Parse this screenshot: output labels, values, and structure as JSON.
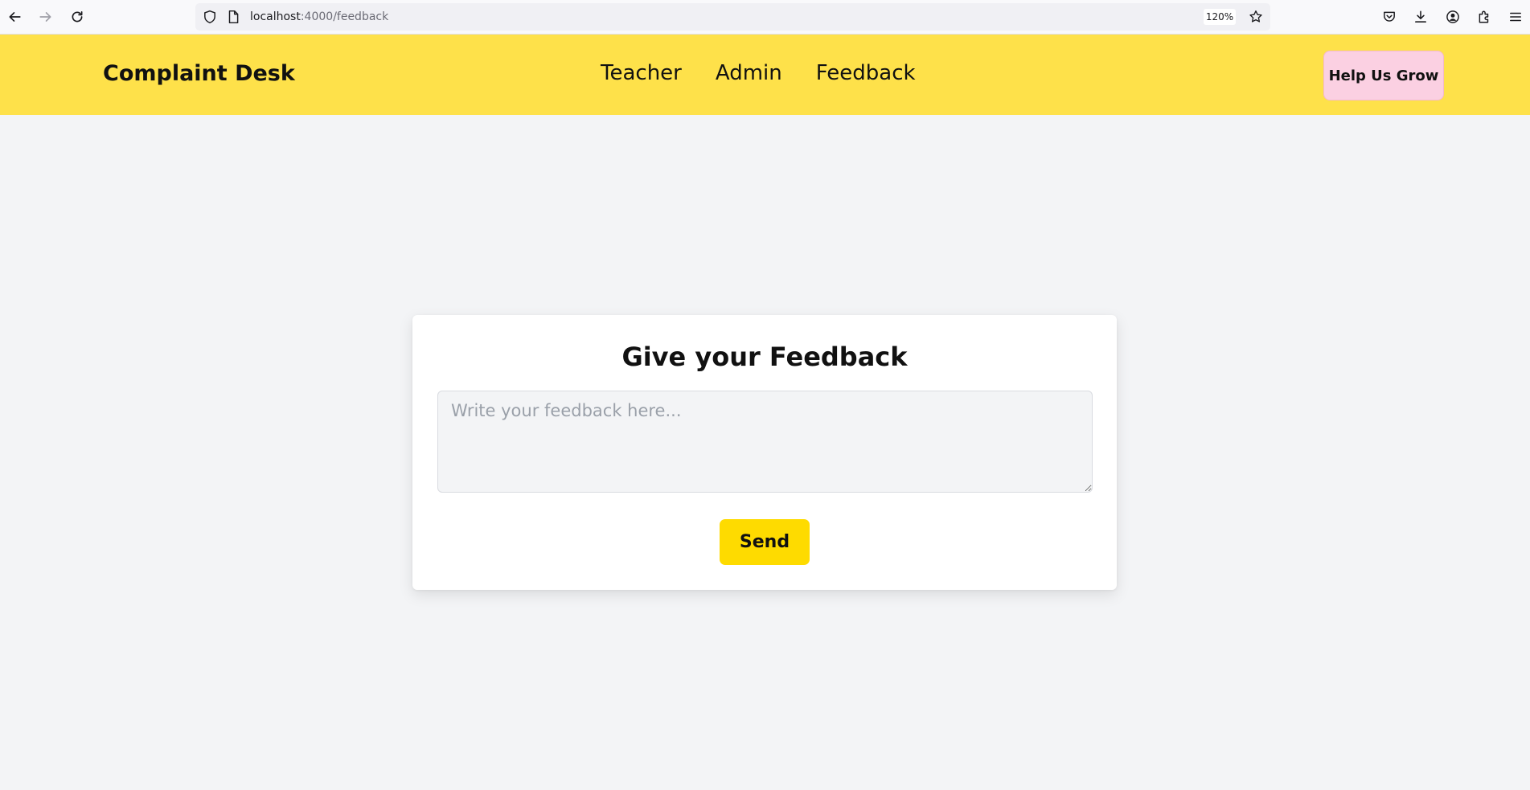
{
  "browser": {
    "url_host": "localhost",
    "url_path": ":4000/feedback",
    "zoom": "120%"
  },
  "header": {
    "brand": "Complaint Desk",
    "nav": [
      "Teacher",
      "Admin",
      "Feedback"
    ],
    "cta": "Help Us Grow"
  },
  "feedback": {
    "title": "Give your Feedback",
    "placeholder": "Write your feedback here...",
    "send_label": "Send"
  },
  "colors": {
    "header_bg": "#fee14a",
    "cta_bg": "#fbd0e2",
    "send_bg": "#fedb00",
    "page_bg": "#f3f4f6"
  }
}
